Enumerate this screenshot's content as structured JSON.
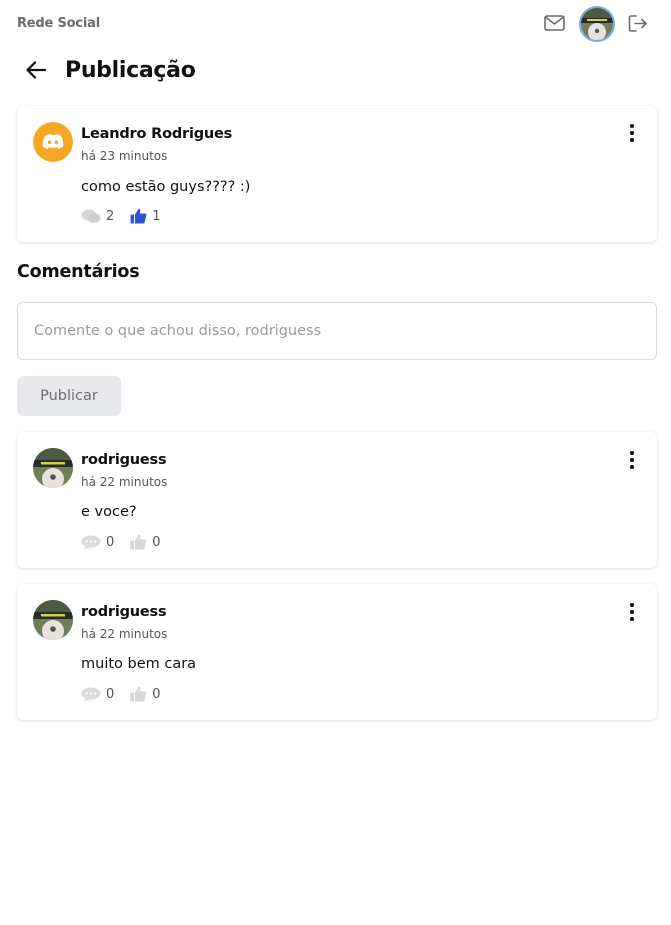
{
  "app": {
    "brand": "Rede Social"
  },
  "header": {
    "title": "Publicação"
  },
  "post": {
    "author": "Leandro Rodrigues",
    "time": "há 23 minutos",
    "text": "como estão guys???? :)",
    "comments_count": "2",
    "likes_count": "1",
    "liked": true
  },
  "comments_section": {
    "title": "Comentários",
    "input_placeholder": "Comente o que achou disso, rodriguess",
    "input_value": "",
    "publish_label": "Publicar"
  },
  "comments": [
    {
      "author": "rodriguess",
      "time": "há 22 minutos",
      "text": "e voce?",
      "comments_count": "0",
      "likes_count": "0"
    },
    {
      "author": "rodriguess",
      "time": "há 22 minutos",
      "text": "muito bem cara",
      "comments_count": "0",
      "likes_count": "0"
    }
  ],
  "colors": {
    "accent_blue": "#2c54d8",
    "discord_avatar_bg": "#f5a623",
    "muted_icon": "#d6d6d6",
    "button_bg": "#e8e9ec"
  },
  "icons": {
    "mail": "mail-icon",
    "logout": "logout-icon",
    "back": "arrow-left-icon",
    "menu": "more-vertical-icon",
    "comment": "comment-bubble-icon",
    "like": "thumbs-up-icon",
    "discord": "discord-logo-icon"
  }
}
